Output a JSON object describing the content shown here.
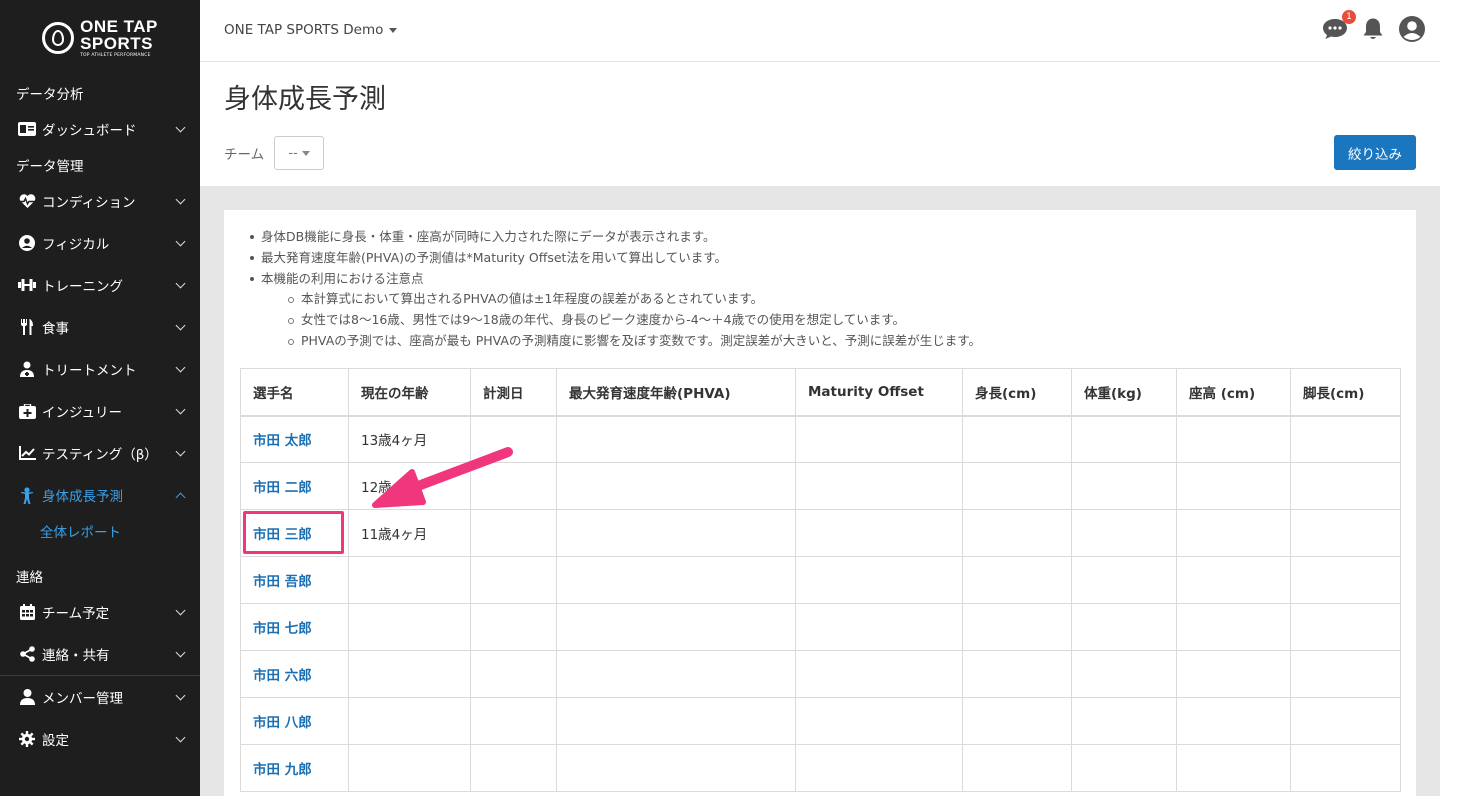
{
  "sidebar": {
    "logo_line1": "ONE TAP",
    "logo_line2": "SPORTS",
    "logo_sub": "TOP ATHLETE PERFORMANCE",
    "section_analysis": "データ分析",
    "section_management": "データ管理",
    "section_contact": "連絡",
    "items": {
      "dashboard": "ダッシュボード",
      "condition": "コンディション",
      "physical": "フィジカル",
      "training": "トレーニング",
      "meal": "食事",
      "treatment": "トリートメント",
      "injury": "インジュリー",
      "testing": "テスティング（β）",
      "growth": "身体成長予測",
      "schedule": "チーム予定",
      "share": "連絡・共有",
      "members": "メンバー管理",
      "settings": "設定"
    },
    "sub_growth_report": "全体レポート"
  },
  "topbar": {
    "team_name": "ONE TAP SPORTS Demo",
    "message_badge": "1"
  },
  "header": {
    "title": "身体成長予測",
    "team_label": "チーム",
    "team_select_value": "--",
    "filter_button": "絞り込み"
  },
  "notes": {
    "line1": "身体DB機能に身長・体重・座高が同時に入力された際にデータが表示されます。",
    "line2": "最大発育速度年齢(PHVA)の予測値は*Maturity Offset法を用いて算出しています。",
    "line3": "本機能の利用における注意点",
    "sub1": "本計算式において算出されるPHVAの値は±1年程度の誤差があるとされています。",
    "sub2": "女性では8～16歳、男性では9～18歳の年代、身長のピーク速度から-4～＋4歳での使用を想定しています。",
    "sub3": "PHVAの予測では、座高が最も PHVAの予測精度に影響を及ぼす変数です。測定誤差が大きいと、予測に誤差が生じます。"
  },
  "table": {
    "headers": [
      "選手名",
      "現在の年齢",
      "計測日",
      "最大発育速度年齢(PHVA)",
      "Maturity Offset",
      "身長(cm)",
      "体重(kg)",
      "座高 (cm)",
      "脚長(cm)"
    ],
    "rows": [
      {
        "name": "市田 太郎",
        "age": "13歳4ヶ月"
      },
      {
        "name": "市田 二郎",
        "age": "12歳"
      },
      {
        "name": "市田 三郎",
        "age": "11歳4ヶ月"
      },
      {
        "name": "市田 吾郎",
        "age": ""
      },
      {
        "name": "市田 七郎",
        "age": ""
      },
      {
        "name": "市田 六郎",
        "age": ""
      },
      {
        "name": "市田 八郎",
        "age": ""
      },
      {
        "name": "市田 九郎",
        "age": ""
      }
    ]
  },
  "colors": {
    "sidebar_bg": "#1e1e1e",
    "accent": "#3aa0e8",
    "link": "#1b6fb3",
    "button": "#1b76c0",
    "highlight": "#f0367c"
  }
}
